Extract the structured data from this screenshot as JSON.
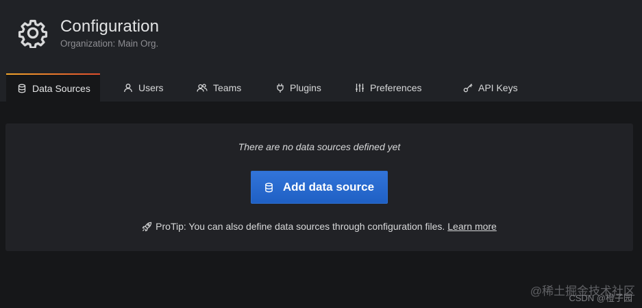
{
  "header": {
    "title": "Configuration",
    "subtitle": "Organization: Main Org."
  },
  "tabs": [
    {
      "label": "Data Sources",
      "icon": "database-icon",
      "active": true
    },
    {
      "label": "Users",
      "icon": "user-icon",
      "active": false
    },
    {
      "label": "Teams",
      "icon": "users-icon",
      "active": false
    },
    {
      "label": "Plugins",
      "icon": "plug-icon",
      "active": false
    },
    {
      "label": "Preferences",
      "icon": "sliders-icon",
      "active": false
    },
    {
      "label": "API Keys",
      "icon": "key-icon",
      "active": false
    }
  ],
  "panel": {
    "empty_message": "There are no data sources defined yet",
    "add_button_label": "Add data source",
    "protip_text": "ProTip: You can also define data sources through configuration files.",
    "learn_more_label": "Learn more"
  },
  "watermark": {
    "line1": "@稀土掘金技术社区",
    "line2": "CSDN @橙子园"
  },
  "colors": {
    "background": "#161719",
    "header_bg": "#202226",
    "panel_bg": "#212226",
    "primary_button": "#3274d9",
    "active_tab_accent": "#f27c2e"
  }
}
